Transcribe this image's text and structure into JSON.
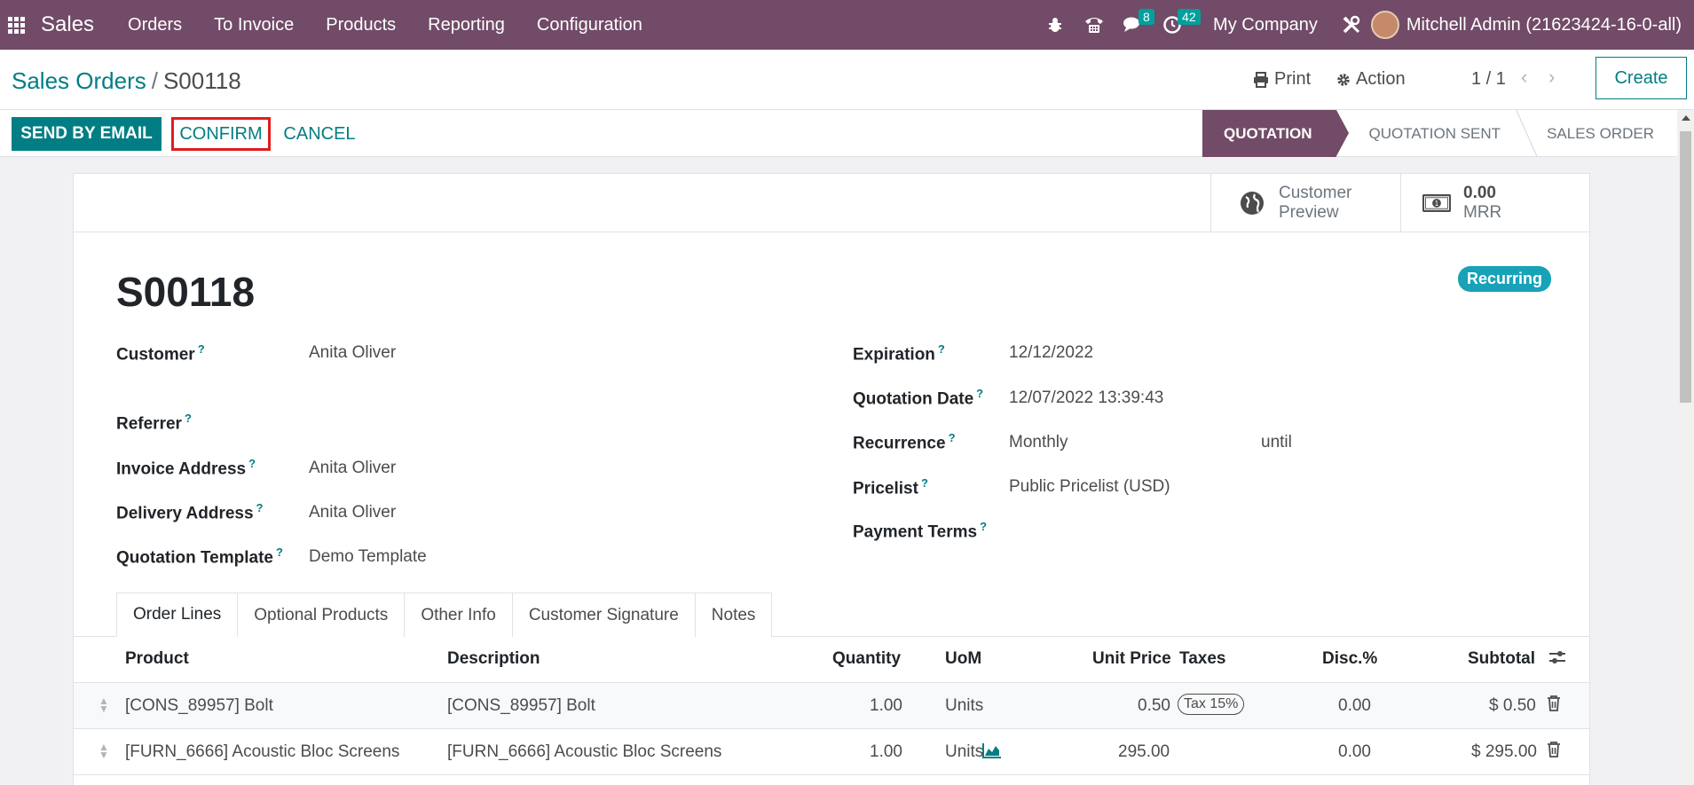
{
  "navbar": {
    "app_name": "Sales",
    "menu": [
      "Orders",
      "To Invoice",
      "Products",
      "Reporting",
      "Configuration"
    ],
    "messages_count": "8",
    "activities_count": "42",
    "company": "My Company",
    "user": "Mitchell Admin (21623424-16-0-all)"
  },
  "control_panel": {
    "breadcrumb_parent": "Sales Orders",
    "breadcrumb_sep": "/",
    "breadcrumb_current": "S00118",
    "print_label": "Print",
    "action_label": "Action",
    "pager": "1 / 1",
    "create_label": "Create"
  },
  "statusbar": {
    "send_email_label": "SEND BY EMAIL",
    "confirm_label": "CONFIRM",
    "cancel_label": "CANCEL",
    "stages": [
      "QUOTATION",
      "QUOTATION SENT",
      "SALES ORDER"
    ],
    "active_stage": "QUOTATION"
  },
  "button_box": {
    "customer_preview": [
      "Customer",
      "Preview"
    ],
    "mrr_value": "0.00",
    "mrr_label": "MRR"
  },
  "record": {
    "ribbon": "Recurring",
    "name": "S00118"
  },
  "fields_left": {
    "customer_label": "Customer",
    "customer_value": "Anita Oliver",
    "referrer_label": "Referrer",
    "invoice_address_label": "Invoice Address",
    "invoice_address_value": "Anita Oliver",
    "delivery_address_label": "Delivery Address",
    "delivery_address_value": "Anita Oliver",
    "quotation_template_label": "Quotation Template",
    "quotation_template_value": "Demo Template"
  },
  "fields_right": {
    "expiration_label": "Expiration",
    "expiration_value": "12/12/2022",
    "quotation_date_label": "Quotation Date",
    "quotation_date_value": "12/07/2022 13:39:43",
    "recurrence_label": "Recurrence",
    "recurrence_value": "Monthly",
    "recurrence_until": "until",
    "pricelist_label": "Pricelist",
    "pricelist_value": "Public Pricelist (USD)",
    "payment_terms_label": "Payment Terms"
  },
  "help_mark": "?",
  "tabs": [
    "Order Lines",
    "Optional Products",
    "Other Info",
    "Customer Signature",
    "Notes"
  ],
  "order_lines": {
    "headers": {
      "product": "Product",
      "description": "Description",
      "quantity": "Quantity",
      "uom": "UoM",
      "unit_price": "Unit Price",
      "taxes": "Taxes",
      "discount": "Disc.%",
      "subtotal": "Subtotal"
    },
    "rows": [
      {
        "product": "[CONS_89957] Bolt",
        "description": "[CONS_89957] Bolt",
        "quantity": "1.00",
        "uom": "Units",
        "unit_price": "0.50",
        "tax": "Tax 15%",
        "discount": "0.00",
        "subtotal": "$ 0.50"
      },
      {
        "product": "[FURN_6666] Acoustic Bloc Screens",
        "description": "[FURN_6666] Acoustic Bloc Screens",
        "quantity": "1.00",
        "uom": "Units",
        "unit_price": "295.00",
        "tax": "",
        "discount": "0.00",
        "subtotal": "$ 295.00"
      }
    ]
  },
  "colors": {
    "brand": "#714b67",
    "accent": "#017e84",
    "ribbon": "#17a2b8",
    "highlight": "#e01c1c"
  }
}
